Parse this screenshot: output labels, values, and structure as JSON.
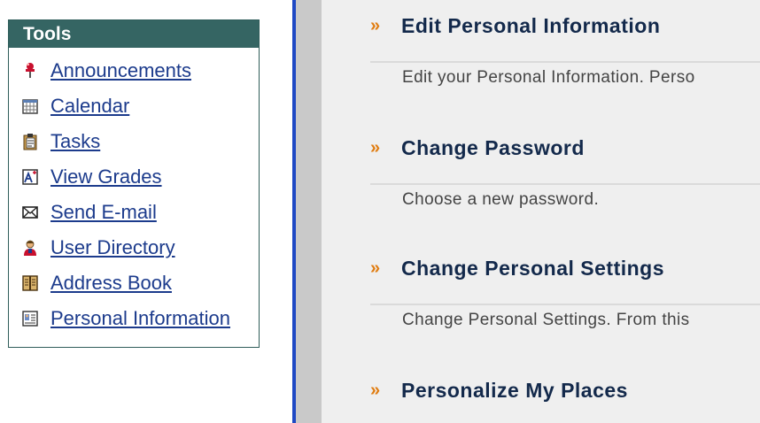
{
  "tools": {
    "title": "Tools",
    "items": [
      {
        "label": "Announcements",
        "icon": "pushpin-icon"
      },
      {
        "label": "Calendar",
        "icon": "calendar-icon"
      },
      {
        "label": "Tasks",
        "icon": "clipboard-icon"
      },
      {
        "label": "View Grades",
        "icon": "grades-icon"
      },
      {
        "label": "Send E-mail",
        "icon": "envelope-icon"
      },
      {
        "label": "User Directory",
        "icon": "user-directory-icon"
      },
      {
        "label": "Address Book",
        "icon": "address-book-icon"
      },
      {
        "label": "Personal Information",
        "icon": "personal-info-icon"
      }
    ]
  },
  "sections": [
    {
      "title": "Edit Personal Information",
      "desc": "Edit your Personal Information. Perso"
    },
    {
      "title": "Change Password",
      "desc": "Choose a new password."
    },
    {
      "title": "Change Personal Settings",
      "desc": "Change Personal Settings. From this"
    },
    {
      "title": "Personalize My Places",
      "desc": ""
    }
  ],
  "colors": {
    "tools_header_bg": "#356563",
    "link": "#1c3b8c",
    "heading": "#13294b",
    "chevron": "#e07c10",
    "divider_blue": "#1f49c4"
  },
  "chevron_glyph": "»"
}
